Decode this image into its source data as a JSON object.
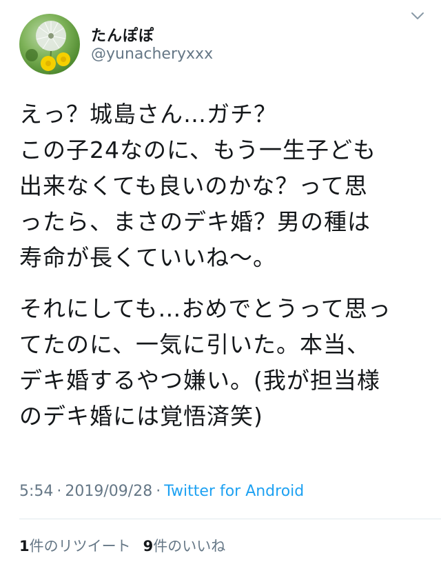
{
  "user": {
    "display_name": "たんぽぽ",
    "handle": "@yunacheryxxx",
    "avatar_icon": "dandelion-avatar-icon"
  },
  "tweet": {
    "paragraphs": [
      [
        "えっ？城島さん…ガチ？",
        "この子24なのに、もう一生子ども",
        "出来なくても良いのかな？って思",
        "ったら、まさのデキ婚？男の種は",
        "寿命が長くていいね〜。"
      ],
      [
        "それにしても…おめでとうって思っ",
        "てたのに、一気に引いた。本当、",
        "デキ婚するやつ嫌い。(我が担当様",
        "のデキ婚には覚悟済笑)"
      ]
    ]
  },
  "meta": {
    "time": "5:54",
    "separator": "·",
    "date": "2019/09/28",
    "source": "Twitter for Android"
  },
  "stats": {
    "retweets_count": "1",
    "retweets_label": "件のリツイート",
    "likes_count": "9",
    "likes_label": "件のいいね"
  },
  "colors": {
    "text": "#14171a",
    "secondary": "#657786",
    "link": "#1da1f2",
    "divider": "#e1e8ed"
  }
}
